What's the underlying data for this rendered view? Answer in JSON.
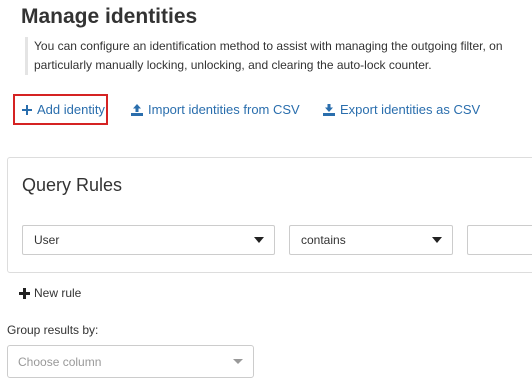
{
  "page": {
    "title": "Manage identities",
    "description_line1": "You can configure an identification method to assist with managing the outgoing filter, on",
    "description_line2": "particularly manually locking, unlocking, and clearing the auto-lock counter."
  },
  "actions": {
    "add_identity": "Add identity",
    "import_csv": "Import identities from CSV",
    "export_csv": "Export identities as CSV"
  },
  "query_rules": {
    "title": "Query Rules",
    "field_value": "User",
    "operator_value": "contains",
    "value_text": ""
  },
  "new_rule_label": "New rule",
  "group_by": {
    "label": "Group results by:",
    "placeholder": "Choose column"
  },
  "colors": {
    "link": "#2a6ead",
    "highlight_border": "#d52323"
  },
  "icons": {
    "add": "plus-icon",
    "import": "upload-icon",
    "export": "download-icon",
    "dropdown": "caret-down-icon"
  }
}
